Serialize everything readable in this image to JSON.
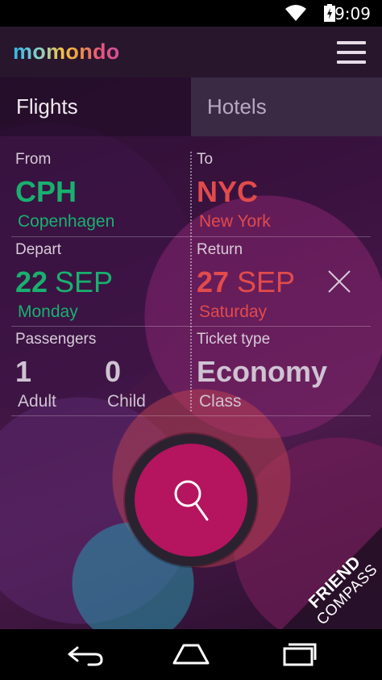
{
  "status_bar": {
    "time": "9:09"
  },
  "header": {
    "logo": "momondo",
    "menu_icon": "hamburger-menu-icon"
  },
  "tabs": [
    {
      "label": "Flights",
      "active": true
    },
    {
      "label": "Hotels",
      "active": false
    }
  ],
  "from": {
    "label": "From",
    "code": "CPH",
    "city": "Copenhagen"
  },
  "to": {
    "label": "To",
    "code": "NYC",
    "city": "New York"
  },
  "depart": {
    "label": "Depart",
    "day": "22",
    "month": "SEP",
    "weekday": "Monday"
  },
  "return": {
    "label": "Return",
    "day": "27",
    "month": "SEP",
    "weekday": "Saturday"
  },
  "passengers": {
    "label": "Passengers",
    "adult_count": "1",
    "adult_label": "Adult",
    "child_count": "0",
    "child_label": "Child"
  },
  "ticket_type": {
    "label": "Ticket type",
    "value": "Economy",
    "sub": "Class"
  },
  "friend_compass": {
    "line1": "FRIEND",
    "line2": "COMPASS"
  },
  "colors": {
    "from_accent": "#19b06f",
    "to_accent": "#e24b4b",
    "search_button": "#b5145e"
  }
}
